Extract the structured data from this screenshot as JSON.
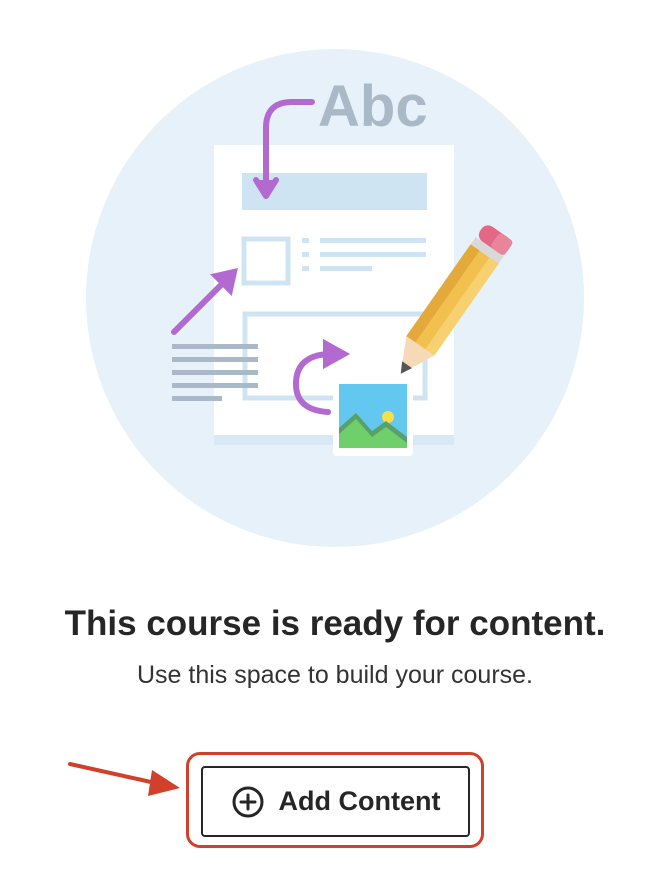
{
  "illustration": {
    "badge_text": "Abc",
    "colors": {
      "circle_bg": "#e6f1fa",
      "doc_lines": "#cfe4f3",
      "arrow_purple": "#b26ad1",
      "pencil_body": "#f2c04e",
      "eraser": "#e46886",
      "image_sky": "#63c8f0",
      "image_hills": "#6fcf6b"
    },
    "icons": [
      "document-icon",
      "pencil-icon",
      "image-icon",
      "text-lines-icon"
    ]
  },
  "empty_state": {
    "title": "This course is ready for content.",
    "subtitle": "Use this space to build your course."
  },
  "actions": {
    "add_content_label": "Add Content",
    "add_content_icon": "plus-circle-icon"
  },
  "annotation": {
    "highlight_color": "#d0402a",
    "pointer": "arrow-right-icon"
  }
}
